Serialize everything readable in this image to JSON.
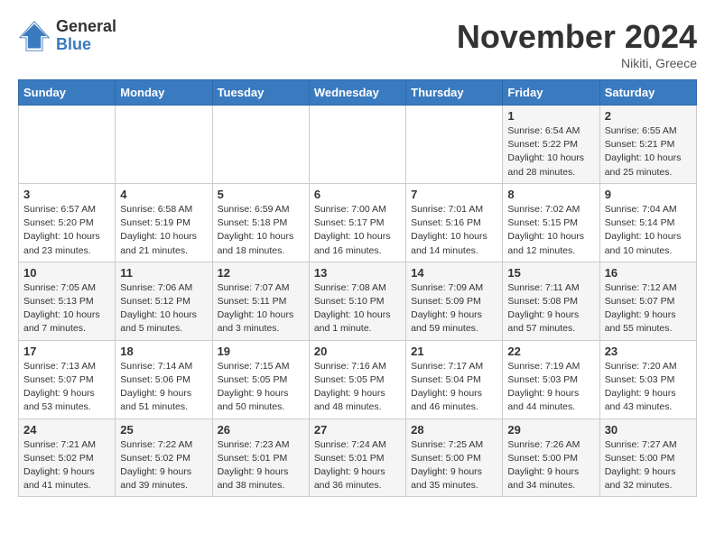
{
  "header": {
    "logo_general": "General",
    "logo_blue": "Blue",
    "month_title": "November 2024",
    "subtitle": "Nikiti, Greece"
  },
  "weekdays": [
    "Sunday",
    "Monday",
    "Tuesday",
    "Wednesday",
    "Thursday",
    "Friday",
    "Saturday"
  ],
  "weeks": [
    [
      {
        "day": "",
        "info": ""
      },
      {
        "day": "",
        "info": ""
      },
      {
        "day": "",
        "info": ""
      },
      {
        "day": "",
        "info": ""
      },
      {
        "day": "",
        "info": ""
      },
      {
        "day": "1",
        "info": "Sunrise: 6:54 AM\nSunset: 5:22 PM\nDaylight: 10 hours and 28 minutes."
      },
      {
        "day": "2",
        "info": "Sunrise: 6:55 AM\nSunset: 5:21 PM\nDaylight: 10 hours and 25 minutes."
      }
    ],
    [
      {
        "day": "3",
        "info": "Sunrise: 6:57 AM\nSunset: 5:20 PM\nDaylight: 10 hours and 23 minutes."
      },
      {
        "day": "4",
        "info": "Sunrise: 6:58 AM\nSunset: 5:19 PM\nDaylight: 10 hours and 21 minutes."
      },
      {
        "day": "5",
        "info": "Sunrise: 6:59 AM\nSunset: 5:18 PM\nDaylight: 10 hours and 18 minutes."
      },
      {
        "day": "6",
        "info": "Sunrise: 7:00 AM\nSunset: 5:17 PM\nDaylight: 10 hours and 16 minutes."
      },
      {
        "day": "7",
        "info": "Sunrise: 7:01 AM\nSunset: 5:16 PM\nDaylight: 10 hours and 14 minutes."
      },
      {
        "day": "8",
        "info": "Sunrise: 7:02 AM\nSunset: 5:15 PM\nDaylight: 10 hours and 12 minutes."
      },
      {
        "day": "9",
        "info": "Sunrise: 7:04 AM\nSunset: 5:14 PM\nDaylight: 10 hours and 10 minutes."
      }
    ],
    [
      {
        "day": "10",
        "info": "Sunrise: 7:05 AM\nSunset: 5:13 PM\nDaylight: 10 hours and 7 minutes."
      },
      {
        "day": "11",
        "info": "Sunrise: 7:06 AM\nSunset: 5:12 PM\nDaylight: 10 hours and 5 minutes."
      },
      {
        "day": "12",
        "info": "Sunrise: 7:07 AM\nSunset: 5:11 PM\nDaylight: 10 hours and 3 minutes."
      },
      {
        "day": "13",
        "info": "Sunrise: 7:08 AM\nSunset: 5:10 PM\nDaylight: 10 hours and 1 minute."
      },
      {
        "day": "14",
        "info": "Sunrise: 7:09 AM\nSunset: 5:09 PM\nDaylight: 9 hours and 59 minutes."
      },
      {
        "day": "15",
        "info": "Sunrise: 7:11 AM\nSunset: 5:08 PM\nDaylight: 9 hours and 57 minutes."
      },
      {
        "day": "16",
        "info": "Sunrise: 7:12 AM\nSunset: 5:07 PM\nDaylight: 9 hours and 55 minutes."
      }
    ],
    [
      {
        "day": "17",
        "info": "Sunrise: 7:13 AM\nSunset: 5:07 PM\nDaylight: 9 hours and 53 minutes."
      },
      {
        "day": "18",
        "info": "Sunrise: 7:14 AM\nSunset: 5:06 PM\nDaylight: 9 hours and 51 minutes."
      },
      {
        "day": "19",
        "info": "Sunrise: 7:15 AM\nSunset: 5:05 PM\nDaylight: 9 hours and 50 minutes."
      },
      {
        "day": "20",
        "info": "Sunrise: 7:16 AM\nSunset: 5:05 PM\nDaylight: 9 hours and 48 minutes."
      },
      {
        "day": "21",
        "info": "Sunrise: 7:17 AM\nSunset: 5:04 PM\nDaylight: 9 hours and 46 minutes."
      },
      {
        "day": "22",
        "info": "Sunrise: 7:19 AM\nSunset: 5:03 PM\nDaylight: 9 hours and 44 minutes."
      },
      {
        "day": "23",
        "info": "Sunrise: 7:20 AM\nSunset: 5:03 PM\nDaylight: 9 hours and 43 minutes."
      }
    ],
    [
      {
        "day": "24",
        "info": "Sunrise: 7:21 AM\nSunset: 5:02 PM\nDaylight: 9 hours and 41 minutes."
      },
      {
        "day": "25",
        "info": "Sunrise: 7:22 AM\nSunset: 5:02 PM\nDaylight: 9 hours and 39 minutes."
      },
      {
        "day": "26",
        "info": "Sunrise: 7:23 AM\nSunset: 5:01 PM\nDaylight: 9 hours and 38 minutes."
      },
      {
        "day": "27",
        "info": "Sunrise: 7:24 AM\nSunset: 5:01 PM\nDaylight: 9 hours and 36 minutes."
      },
      {
        "day": "28",
        "info": "Sunrise: 7:25 AM\nSunset: 5:00 PM\nDaylight: 9 hours and 35 minutes."
      },
      {
        "day": "29",
        "info": "Sunrise: 7:26 AM\nSunset: 5:00 PM\nDaylight: 9 hours and 34 minutes."
      },
      {
        "day": "30",
        "info": "Sunrise: 7:27 AM\nSunset: 5:00 PM\nDaylight: 9 hours and 32 minutes."
      }
    ]
  ]
}
